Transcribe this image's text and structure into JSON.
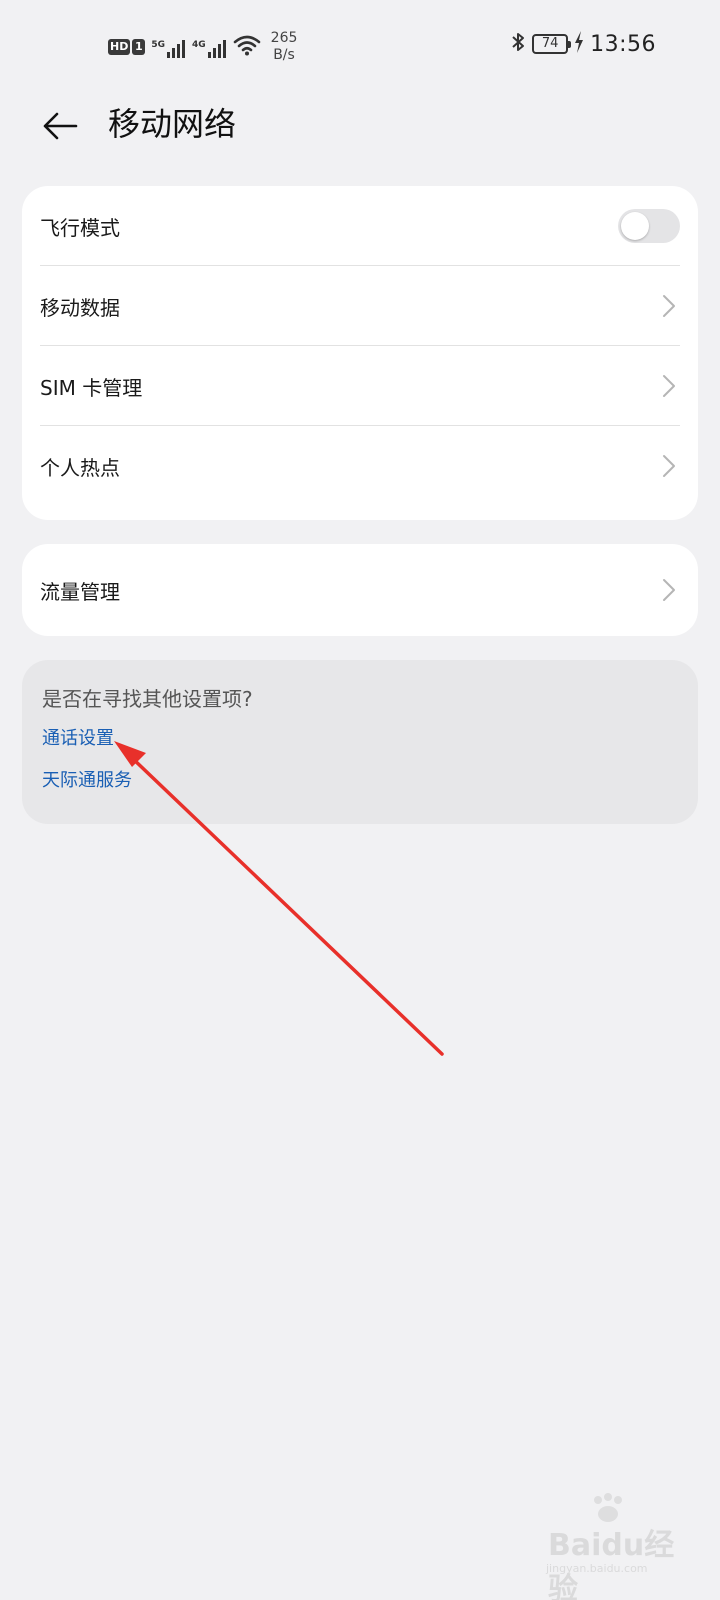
{
  "status_bar": {
    "hd_label": "HD",
    "sim_label": "1",
    "sig1_tag": "5G",
    "sig2_tag": "4G",
    "speed_value": "265",
    "speed_unit": "B/s",
    "battery": "74",
    "time": "13:56"
  },
  "header": {
    "title": "移动网络"
  },
  "settings": {
    "items": [
      {
        "label": "飞行模式",
        "type": "toggle",
        "state": "off"
      },
      {
        "label": "移动数据",
        "type": "nav"
      },
      {
        "label": "SIM 卡管理",
        "type": "nav"
      },
      {
        "label": "个人热点",
        "type": "nav"
      }
    ]
  },
  "data_card": {
    "label": "流量管理"
  },
  "suggestions": {
    "question": "是否在寻找其他设置项?",
    "links": [
      "通话设置",
      "天际通服务"
    ]
  },
  "watermark": {
    "brand": "Baidu经验",
    "sub": "jingyan.baidu.com"
  },
  "colors": {
    "background": "#f1f1f3",
    "card": "#ffffff",
    "link": "#1a5fb4",
    "annotation_arrow": "#e8302a"
  }
}
